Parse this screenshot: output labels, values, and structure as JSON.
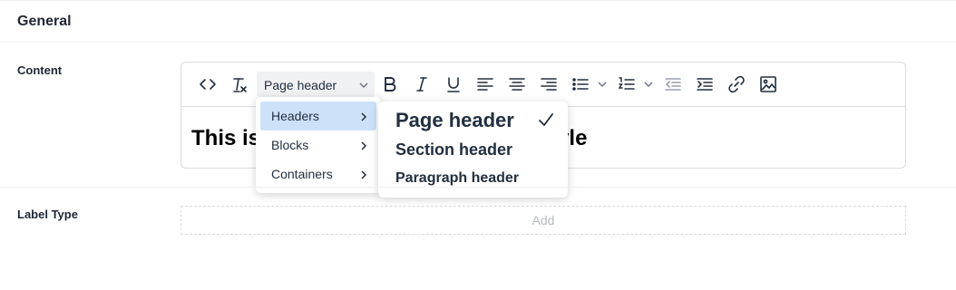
{
  "section": {
    "title": "General"
  },
  "content_field": {
    "label": "Content",
    "toolbar": {
      "format_select": "Page header",
      "buttons": [
        "source-code",
        "clear-formatting",
        "bold",
        "italic",
        "underline",
        "align-left",
        "align-center",
        "align-right",
        "bullet-list",
        "numbered-list",
        "outdent",
        "indent",
        "link",
        "image"
      ]
    },
    "body_visible_left": "This is",
    "body_visible_right": "r' style",
    "format_menu": {
      "items": [
        {
          "label": "Headers",
          "active": true
        },
        {
          "label": "Blocks",
          "active": false
        },
        {
          "label": "Containers",
          "active": false
        }
      ],
      "submenu": [
        {
          "label": "Page header",
          "checked": true
        },
        {
          "label": "Section header",
          "checked": false
        },
        {
          "label": "Paragraph header",
          "checked": false
        }
      ]
    }
  },
  "label_type_field": {
    "label": "Label Type",
    "add_label": "Add"
  },
  "colors": {
    "active_menu_bg": "#cde1f9",
    "border": "#d8dbe0",
    "select_bg": "#f0f1f3"
  }
}
